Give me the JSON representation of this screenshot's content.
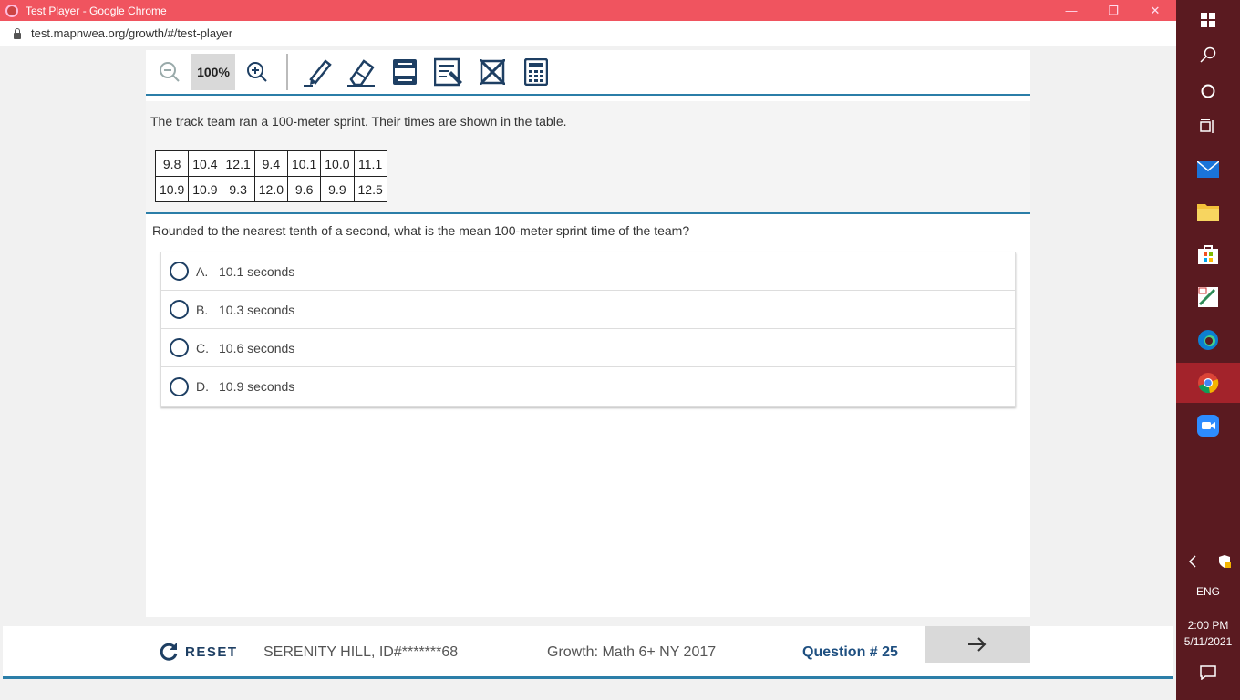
{
  "window": {
    "title": "Test Player - Google Chrome",
    "url": "test.mapnwea.org/growth/#/test-player"
  },
  "toolbar": {
    "zoom_level": "100%",
    "tools": [
      "zoom-out-icon",
      "zoom-in-icon",
      "highlighter-icon",
      "eraser-icon",
      "line-reader-icon",
      "notepad-icon",
      "answer-eliminator-icon",
      "calculator-icon"
    ]
  },
  "stimulus": {
    "text": "The track team ran a 100-meter sprint. Their times are shown in the table.",
    "table": [
      [
        "9.8",
        "10.4",
        "12.1",
        "9.4",
        "10.1",
        "10.0",
        "11.1"
      ],
      [
        "10.9",
        "10.9",
        "9.3",
        "12.0",
        "9.6",
        "9.9",
        "12.5"
      ]
    ]
  },
  "question": {
    "prompt": "Rounded to the nearest tenth of a second, what is the mean 100-meter sprint time of the team?",
    "choices": [
      {
        "letter": "A.",
        "text": "10.1 seconds"
      },
      {
        "letter": "B.",
        "text": "10.3 seconds"
      },
      {
        "letter": "C.",
        "text": "10.6 seconds"
      },
      {
        "letter": "D.",
        "text": "10.9 seconds"
      }
    ]
  },
  "bottombar": {
    "reset_label": "RESET",
    "student": "SERENITY HILL, ID#*******68",
    "test_name": "Growth: Math 6+ NY 2017",
    "question_number": "Question # 25"
  },
  "taskbar": {
    "language": "ENG",
    "time": "2:00 PM",
    "date": "5/11/2021"
  },
  "colors": {
    "accent": "#2b7ea8",
    "navy": "#1e3f63",
    "titlebar": "#f0545f",
    "taskbar": "#5a1a20"
  }
}
